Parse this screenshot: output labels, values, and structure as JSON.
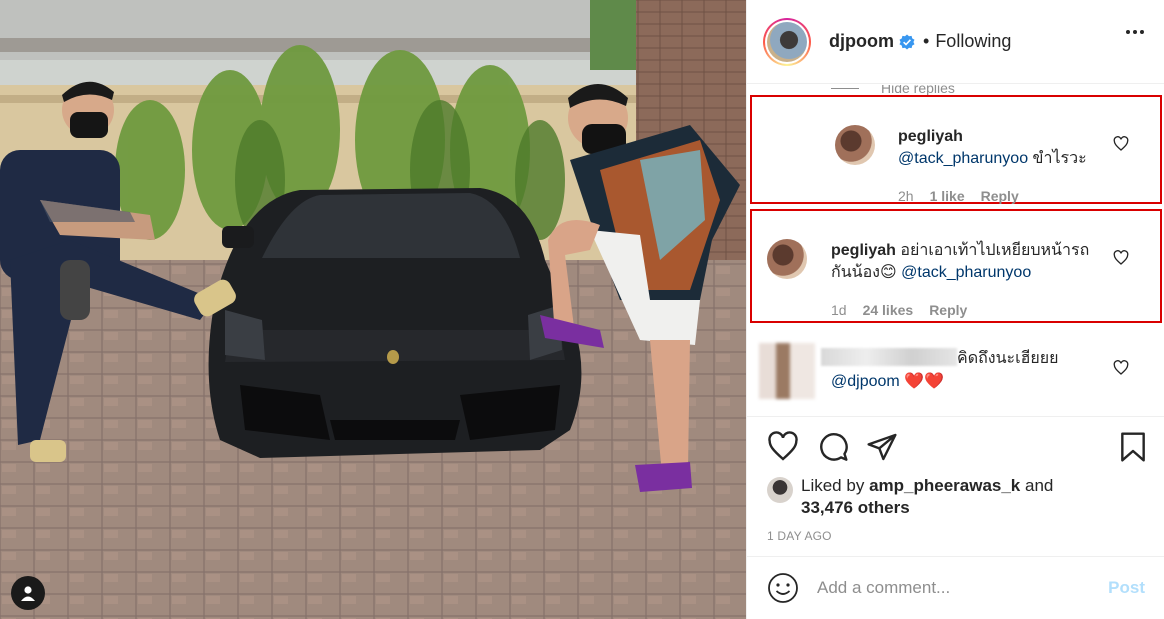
{
  "photo": {
    "user_tag_icon": "user-tag-icon"
  },
  "header": {
    "username": "djpoom",
    "separator": "•",
    "follow_state": "Following",
    "verified_icon": "verified-badge-icon",
    "more_icon": "more-options-icon"
  },
  "comments": {
    "hide_replies": "Hide replies",
    "items": [
      {
        "author": "pegliyah",
        "mention": "@tack_pharunyoo",
        "text": " ขำไรวะ",
        "time": "2h",
        "likes": "1 like",
        "reply": "Reply",
        "highlighted": true
      },
      {
        "author": "pegliyah",
        "text": " อย่าเอาเท้าไปเหยียบหน้ารถกันน้อง",
        "emoji": "😊",
        "mention": "@tack_pharunyoo",
        "time": "1d",
        "likes": "24 likes",
        "reply": "Reply",
        "highlighted": true
      },
      {
        "author": "",
        "text": "คิดถึงนะเฮียยย",
        "mention": "@djpoom",
        "emoji": "❤️❤️",
        "highlighted": false
      }
    ]
  },
  "actions": {
    "like_icon": "heart-outline-icon",
    "comment_icon": "comment-bubble-icon",
    "share_icon": "paper-plane-icon",
    "save_icon": "bookmark-icon",
    "liked_by_prefix": "Liked by",
    "liked_by_user": "amp_pheerawas_k",
    "liked_by_and": "and",
    "others_count": "33,476 others",
    "time_ago": "1 DAY AGO"
  },
  "add_comment": {
    "emoji_icon": "smiley-icon",
    "placeholder": "Add a comment...",
    "post_label": "Post"
  },
  "colors": {
    "highlight_border": "#d90000",
    "mention": "#00376b",
    "post_disabled": "#b2dffc",
    "verified": "#3897f0"
  }
}
